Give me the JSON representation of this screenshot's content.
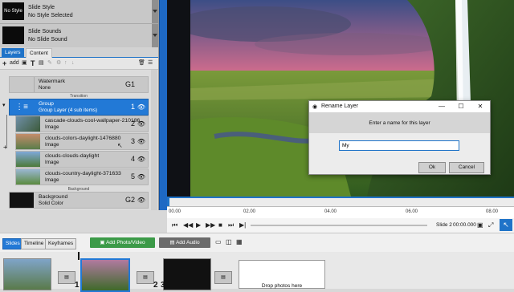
{
  "style_panel": {
    "slide_style": {
      "thumb": "No Style",
      "title": "Slide Style",
      "value": "No Style Selected"
    },
    "slide_sounds": {
      "title": "Slide Sounds",
      "value": "No Slide Sound"
    }
  },
  "panel_tabs": {
    "layers": "Layers",
    "content": "Content"
  },
  "layer_toolbar": {
    "add": "add"
  },
  "layers": [
    {
      "name": "Watermark",
      "type": "None",
      "number": "G1"
    },
    {
      "divider": "Transition"
    },
    {
      "name": "Group",
      "type": "Group Layer (4 sub items)",
      "number": "1",
      "selected": true
    },
    {
      "name": "cascade-clouds-cool-wallpaper-210186",
      "type": "Image",
      "number": "2"
    },
    {
      "name": "clouds-colors-daylight-1476880",
      "type": "Image",
      "number": "3"
    },
    {
      "name": "clouds-clouds-daylight",
      "type": "Image",
      "number": "4"
    },
    {
      "name": "clouds-country-daylight-371633",
      "type": "Image",
      "number": "5"
    },
    {
      "divider": "Background"
    },
    {
      "name": "Background",
      "type": "Solid Color",
      "number": "G2"
    }
  ],
  "timeline": {
    "ticks": [
      "00.00",
      "02.00",
      "04.00",
      "06.00",
      "08.00"
    ],
    "slide_label": "Slide 2",
    "time": "00:00.000"
  },
  "bottom_tabs": {
    "slides": "Slides",
    "timeline": "Timeline",
    "keyframes": "Keyframes"
  },
  "actions": {
    "add_photo": "Add Photo/Video",
    "add_audio": "Add Audio"
  },
  "slides": {
    "numbers": [
      "1",
      "2",
      "3"
    ],
    "drop_text": "Drop photos here"
  },
  "dialog": {
    "title": "Rename Layer",
    "prompt": "Enter a name for this layer",
    "input_value": "My",
    "ok": "Ok",
    "cancel": "Cancel"
  },
  "colors": {
    "accent": "#1f73c8",
    "selected_layer": "#2279d6",
    "add_photo": "#3c9a48",
    "add_audio": "#6b6b6b"
  }
}
